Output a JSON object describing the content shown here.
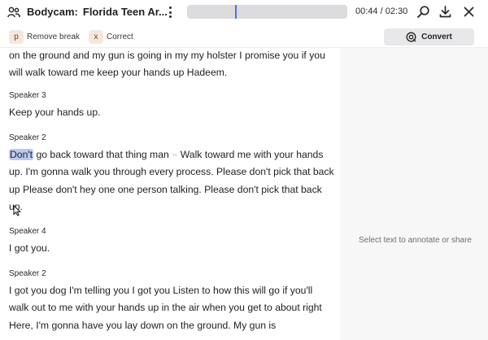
{
  "header": {
    "app_name": "Bodycam",
    "title": "Florida Teen Ar...",
    "timecode": "00:44 / 02:30",
    "progress_fraction": 0.3
  },
  "toolbar": {
    "shortcuts": [
      {
        "key": "p",
        "label": "Remove break"
      },
      {
        "key": "x",
        "label": "Correct"
      }
    ],
    "convert_label": "Convert"
  },
  "transcript": {
    "segments": [
      {
        "speaker": "",
        "text": "on the ground and my gun is going in my my holster I promise you if you will walk toward me keep your hands up Hadeem."
      },
      {
        "speaker": "Speaker 3",
        "text": "Keep your hands up."
      },
      {
        "speaker": "Speaker 2",
        "highlighted_word": "Don't",
        "text_before_pause": "go back toward that thing man",
        "text_after_pause": "Walk toward me with your hands up. I'm gonna walk you through every process. Please don't pick that back up Please don't hey one one person talking. Please don't pick that back up."
      },
      {
        "speaker": "Speaker 4",
        "text": "I got you."
      },
      {
        "speaker": "Speaker 2",
        "text": "I got you dog I'm telling you I got you Listen to how this will go if you'll walk out to me with your hands up in the air when you get to about right Here, I'm gonna have you lay down on the ground. My gun is"
      }
    ]
  },
  "side_panel": {
    "hint": "Select text to annotate or share"
  },
  "colors": {
    "highlight": "#b9c9f2",
    "playhead": "#4a74d6",
    "key_chip": "#f6e7da"
  }
}
